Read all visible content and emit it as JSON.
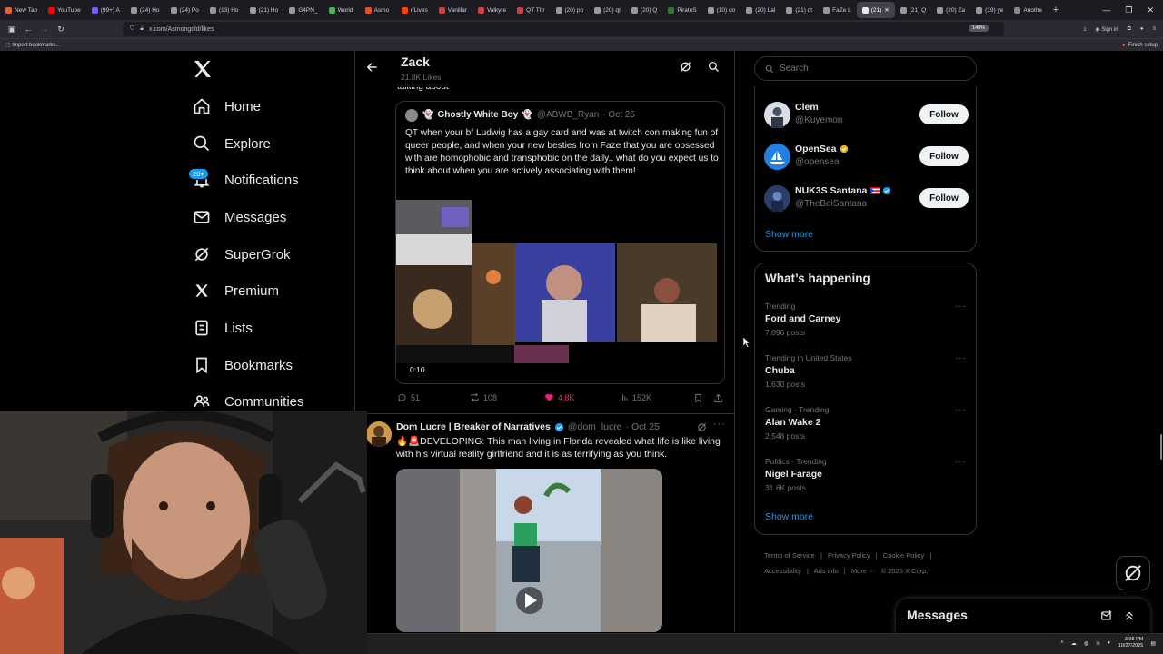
{
  "browser": {
    "tabs": [
      {
        "label": "New Tab"
      },
      {
        "label": "YouTube"
      },
      {
        "label": "(99+) A"
      },
      {
        "label": "(24) Ho"
      },
      {
        "label": "(24) Po"
      },
      {
        "label": "(13) Ho"
      },
      {
        "label": "(21) Ho"
      },
      {
        "label": "G4PN_"
      },
      {
        "label": "World"
      },
      {
        "label": "Asmo"
      },
      {
        "label": "r/Lives"
      },
      {
        "label": "Vanillar"
      },
      {
        "label": "Valkyre"
      },
      {
        "label": "QT Thr"
      },
      {
        "label": "(20) po"
      },
      {
        "label": "(20) qt"
      },
      {
        "label": "(20) Q"
      },
      {
        "label": "PirateS"
      },
      {
        "label": "(10) do"
      },
      {
        "label": "(20) Lal"
      },
      {
        "label": "(21) qt"
      },
      {
        "label": "FaZe L"
      },
      {
        "label": "(21)",
        "active": true
      },
      {
        "label": "(21) Q"
      },
      {
        "label": "(20) Za"
      },
      {
        "label": "(19) ye"
      },
      {
        "label": "Anothe"
      }
    ],
    "url": "x.com/Asmongold/likes",
    "zoom": "140%",
    "sign_in": "Sign in",
    "bookmark_import": "Import bookmarks...",
    "finish_setup": "Finish setup"
  },
  "sidebar": {
    "notif_badge": "20+",
    "items": [
      {
        "label": "Home",
        "icon": "home-icon"
      },
      {
        "label": "Explore",
        "icon": "search-icon"
      },
      {
        "label": "Notifications",
        "icon": "bell-icon"
      },
      {
        "label": "Messages",
        "icon": "mail-icon"
      },
      {
        "label": "SuperGrok",
        "icon": "grok-icon"
      },
      {
        "label": "Premium",
        "icon": "x-icon"
      },
      {
        "label": "Lists",
        "icon": "list-icon"
      },
      {
        "label": "Bookmarks",
        "icon": "bookmark-icon"
      },
      {
        "label": "Communities",
        "icon": "communities-icon"
      }
    ]
  },
  "header": {
    "name": "Zack",
    "likes": "21.8K Likes"
  },
  "post1": {
    "trailing_text": "talking about",
    "quote": {
      "name": "Ghostly White Boy",
      "handle": "@ABWB_Ryan",
      "date": "· Oct 25",
      "text": "QT when your bf Ludwig has a gay card and was at twitch con making fun of queer people, and when your new besties from Faze that you are obsessed with are homophobic and transphobic on the daily.. what do you expect us to think about when you are actively associating with them!",
      "duration": "0:10"
    },
    "actions": {
      "replies": "51",
      "reposts": "108",
      "likes": "4.8K",
      "views": "152K"
    }
  },
  "post2": {
    "name": "Dom Lucre | Breaker of Narratives",
    "handle": "@dom_lucre",
    "date": "· Oct 25",
    "text": "🔥🚨DEVELOPING: This man living in Florida revealed what life is like living with his virtual reality girlfriend and it is as terrifying as you think."
  },
  "right": {
    "search_placeholder": "Search",
    "who_to_follow": [
      {
        "name": "Clem",
        "handle": "@Kuyemon",
        "button": "Follow",
        "avatar_color": "#3a4a66"
      },
      {
        "name": "OpenSea",
        "handle": "@opensea",
        "button": "Follow",
        "avatar_color": "#2081e2"
      },
      {
        "name": "NUK3S Santana",
        "handle": "@TheBoiSantana",
        "button": "Follow",
        "avatar_color": "#243a5e"
      }
    ],
    "show_more": "Show more",
    "trends_title": "What’s happening",
    "trends": [
      {
        "context": "Trending",
        "title": "Ford and Carney",
        "count": "7,096 posts"
      },
      {
        "context": "Trending in United States",
        "title": "Chuba",
        "count": "1,630 posts"
      },
      {
        "context": "Gaming · Trending",
        "title": "Alan Wake 2",
        "count": "2,548 posts"
      },
      {
        "context": "Politics · Trending",
        "title": "Nigel Farage",
        "count": "31.6K posts"
      }
    ],
    "trends_show_more": "Show more",
    "footer": [
      "Terms of Service",
      "|",
      "Privacy Policy",
      "|",
      "Cookie Policy",
      "|",
      "Accessibility",
      "|",
      "Ads info",
      "|",
      "More ···",
      "© 2025 X Corp."
    ]
  },
  "messages_drawer": {
    "label": "Messages"
  },
  "taskbar": {
    "time": "3:08 PM",
    "date": "10/27/2025"
  },
  "colors": {
    "accent": "#1d9bf0",
    "like": "#f91880",
    "border": "#2f3336",
    "muted": "#71767b"
  }
}
